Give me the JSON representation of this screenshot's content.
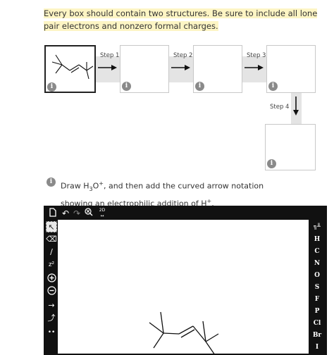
{
  "instruction": "Every box should contain two structures. Be sure to include all lone pair electrons and nonzero formal charges.",
  "steps": [
    {
      "label": "Step 1"
    },
    {
      "label": "Step 2"
    },
    {
      "label": "Step 3"
    },
    {
      "label": "Step 4"
    }
  ],
  "info_glyph": "i",
  "prompt": {
    "prefix": "Draw H",
    "sub": "3",
    "mid": "O",
    "sup": "+",
    "suffix": ", and then add the curved arrow notation showing an electrophilic addition of H",
    "sup2": "+",
    "end": "."
  },
  "editor": {
    "toolbar": {
      "move_label": "2D"
    },
    "left_tools": {
      "charge_label": "z²",
      "lonepair_label": "••"
    },
    "elements": [
      "H",
      "C",
      "N",
      "O",
      "S",
      "F",
      "P",
      "Cl",
      "Br",
      "I"
    ],
    "periodic_label": "╗╨"
  },
  "colors": {
    "highlight": "#fdf5c4",
    "step_bg": "#e4e4e4",
    "toolbar": "#111111"
  }
}
